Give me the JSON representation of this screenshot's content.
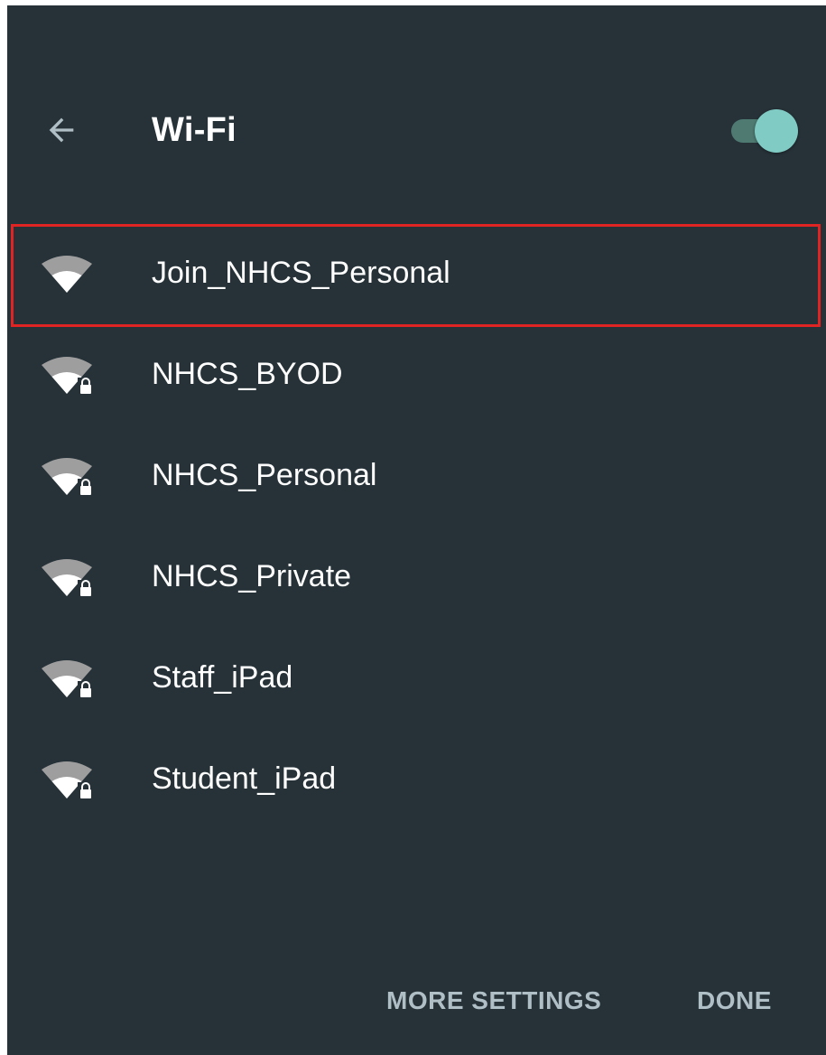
{
  "header": {
    "title": "Wi-Fi",
    "back_icon": "arrow-back-icon",
    "wifi_enabled": true
  },
  "networks": [
    {
      "ssid": "Join_NHCS_Personal",
      "secured": false,
      "highlighted": true,
      "icon": "wifi-icon"
    },
    {
      "ssid": "NHCS_BYOD",
      "secured": true,
      "highlighted": false,
      "icon": "wifi-lock-icon"
    },
    {
      "ssid": "NHCS_Personal",
      "secured": true,
      "highlighted": false,
      "icon": "wifi-lock-icon"
    },
    {
      "ssid": "NHCS_Private",
      "secured": true,
      "highlighted": false,
      "icon": "wifi-lock-icon"
    },
    {
      "ssid": "Staff_iPad",
      "secured": true,
      "highlighted": false,
      "icon": "wifi-lock-icon"
    },
    {
      "ssid": "Student_iPad",
      "secured": true,
      "highlighted": false,
      "icon": "wifi-lock-icon"
    }
  ],
  "actions": {
    "more_settings_label": "MORE SETTINGS",
    "done_label": "DONE"
  },
  "colors": {
    "background": "#263238",
    "accent": "#80cbc4",
    "highlight_border": "#e02424",
    "action_text": "#b0bec5"
  }
}
